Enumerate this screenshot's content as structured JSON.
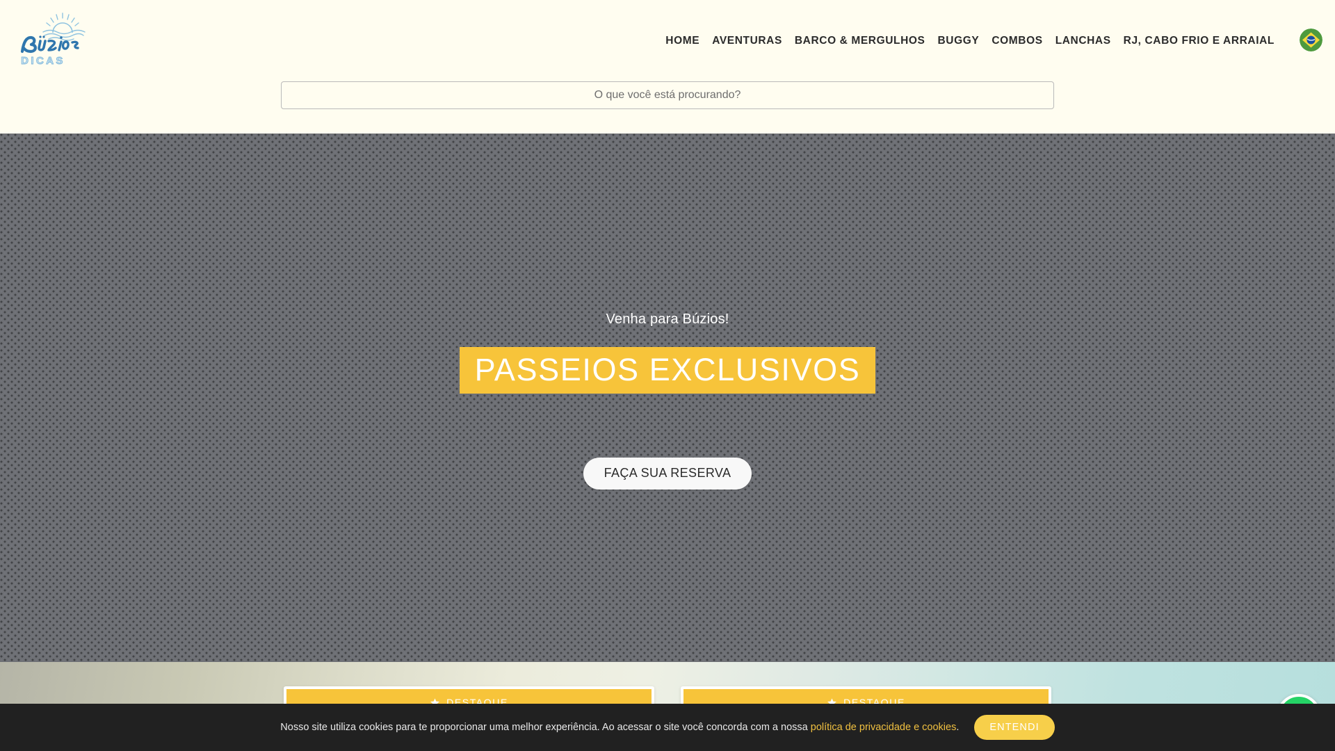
{
  "site": {
    "logo_script": "Búzios",
    "logo_sub": "DICAS",
    "logo_icon": "sun-waves-icon"
  },
  "header": {
    "background": "#FFFDF0",
    "nav": [
      {
        "label": "HOME",
        "name": "nav-home"
      },
      {
        "label": "AVENTURAS",
        "name": "nav-aventuras"
      },
      {
        "label": "BARCO & MERGULHOS",
        "name": "nav-barco-mergulhos"
      },
      {
        "label": "BUGGY",
        "name": "nav-buggy"
      },
      {
        "label": "COMBOS",
        "name": "nav-combos"
      },
      {
        "label": "LANCHAS",
        "name": "nav-lanchas"
      },
      {
        "label": "RJ, CABO FRIO E ARRAIAL",
        "name": "nav-rj-cabo-frio-arraial"
      }
    ],
    "language_flag": "brazil-flag-icon"
  },
  "search": {
    "placeholder": "O que você está procurando?",
    "value": ""
  },
  "hero": {
    "kicker": "Venha para Búzios!",
    "title": "PASSEIOS EXCLUSIVOS",
    "title_bg": "#F7C43A",
    "cta_label": "FAÇA SUA RESERVA",
    "background_state": "image-placeholder-pattern"
  },
  "featured": {
    "cards": [
      {
        "badge": "DESTAQUE",
        "badge_icon": "star-icon"
      },
      {
        "badge": "DESTAQUE",
        "badge_icon": "star-icon"
      }
    ],
    "badge_color": "#F7C43A"
  },
  "floating": {
    "whatsapp_label": "whatsapp-icon",
    "whatsapp_color": "#25D366"
  },
  "cookie": {
    "text_before": "Nosso site utiliza cookies para te proporcionar uma melhor experiência. Ao acessar o site você concorda com a nossa ",
    "link_label": "política de privacidade e cookies",
    "text_after": ".",
    "accept_label": "ENTENDI",
    "accent": "#F7CF4A"
  }
}
